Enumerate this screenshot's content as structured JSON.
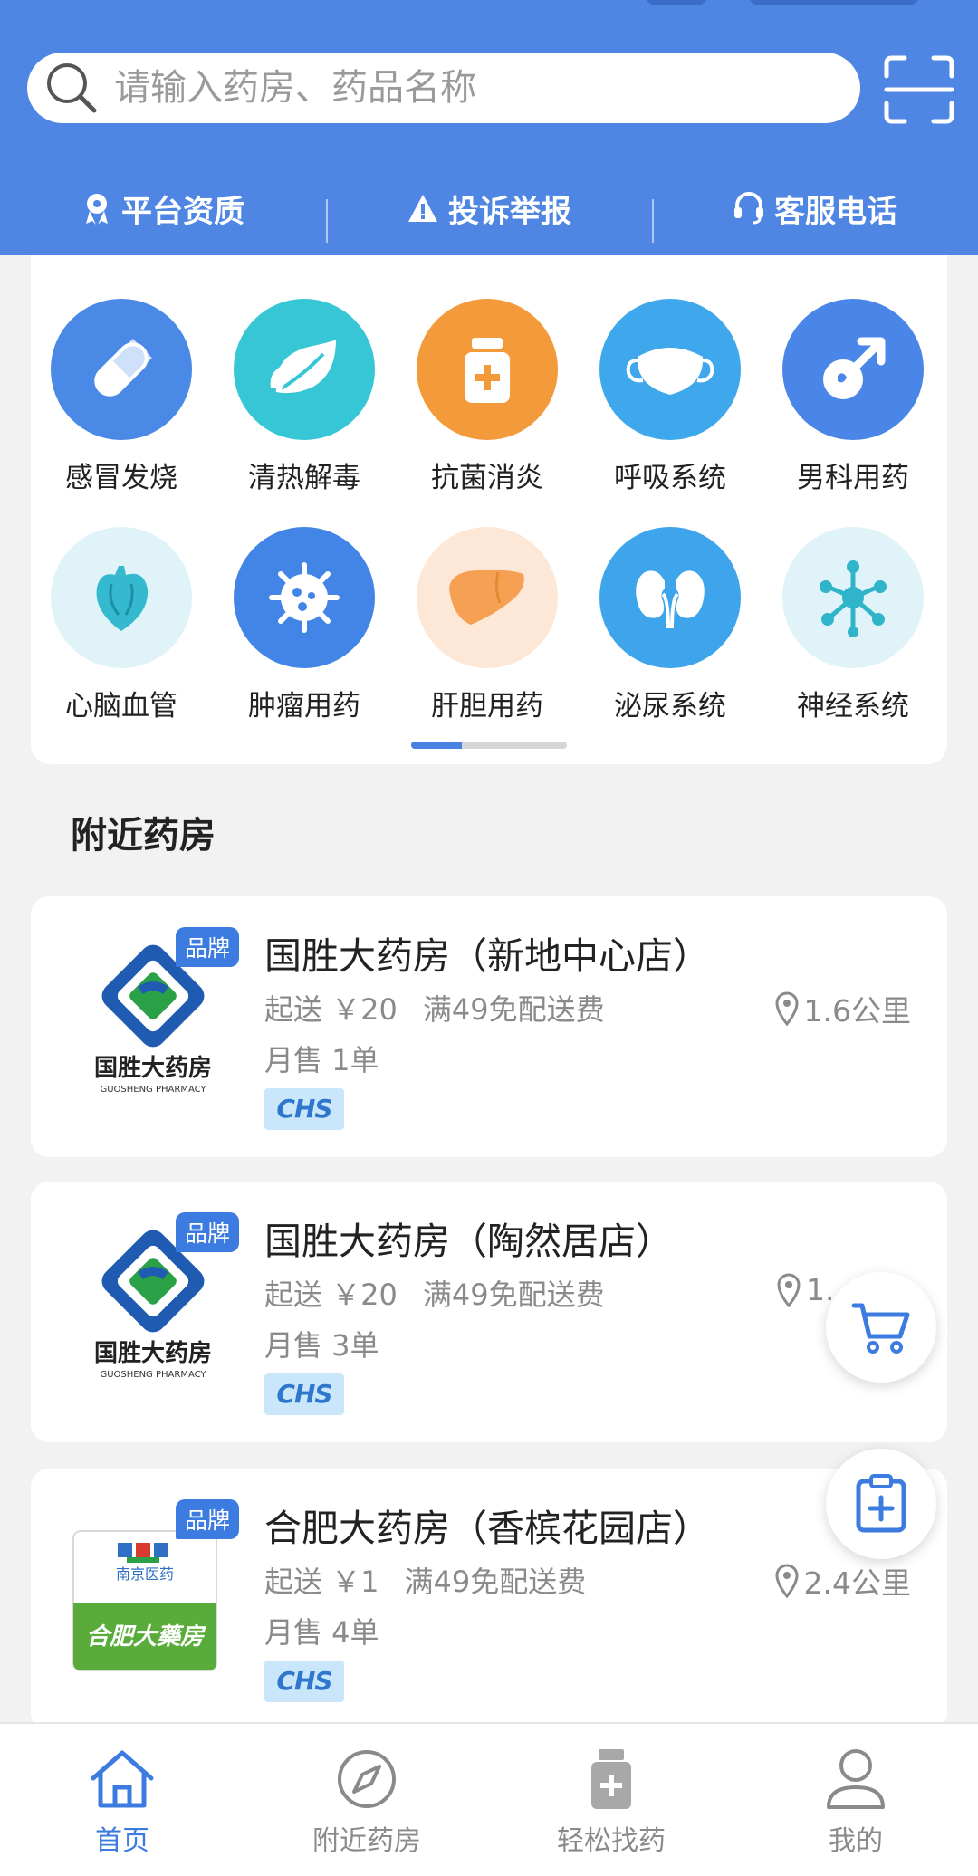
{
  "header": {
    "search_placeholder": "请输入药房、药品名称",
    "links": [
      {
        "label": "平台资质",
        "icon": "qualification-icon"
      },
      {
        "label": "投诉举报",
        "icon": "warning-icon"
      },
      {
        "label": "客服电话",
        "icon": "headset-icon"
      }
    ]
  },
  "categories": [
    {
      "label": "感冒发烧",
      "icon": "pill-icon",
      "color": "#4a8ae6"
    },
    {
      "label": "清热解毒",
      "icon": "leaf-icon",
      "color": "#36c6d6"
    },
    {
      "label": "抗菌消炎",
      "icon": "medicine-bottle-icon",
      "color": "#f39a3b"
    },
    {
      "label": "呼吸系统",
      "icon": "mask-icon",
      "color": "#3fa8ec"
    },
    {
      "label": "男科用药",
      "icon": "male-symbol-icon",
      "color": "#4a85e8"
    },
    {
      "label": "心脑血管",
      "icon": "heart-icon",
      "color": "#dff3f8"
    },
    {
      "label": "肿瘤用药",
      "icon": "virus-icon",
      "color": "#4385e6"
    },
    {
      "label": "肝胆用药",
      "icon": "liver-icon",
      "color": "#fde7d6"
    },
    {
      "label": "泌尿系统",
      "icon": "kidney-icon",
      "color": "#3ea5ec"
    },
    {
      "label": "神经系统",
      "icon": "neuron-icon",
      "color": "#dff3f8"
    }
  ],
  "section": {
    "title": "附近药房"
  },
  "pharmacies": [
    {
      "badge": "品牌",
      "name": "国胜大药房（新地中心店）",
      "delivery": "起送 ￥20",
      "free": "满49免配送费",
      "monthly": "月售 1单",
      "distance": "1.6公里",
      "tag": "CHS",
      "logo_text": "国胜大药房",
      "logo_sub": "GUOSHENG PHARMACY"
    },
    {
      "badge": "品牌",
      "name": "国胜大药房（陶然居店）",
      "delivery": "起送 ￥20",
      "free": "满49免配送费",
      "monthly": "月售 3单",
      "distance": "1.",
      "tag": "CHS",
      "logo_text": "国胜大药房",
      "logo_sub": "GUOSHENG PHARMACY"
    },
    {
      "badge": "品牌",
      "name": "合肥大药房（香槟花园店）",
      "delivery": "起送 ￥1",
      "free": "满49免配送费",
      "monthly": "月售 4单",
      "distance": "2.4公里",
      "tag": "CHS",
      "logo_text": "合肥大藥房",
      "logo_sub": "南京医药"
    }
  ],
  "bottom_nav": [
    {
      "label": "首页",
      "icon": "home-icon",
      "active": true
    },
    {
      "label": "附近药房",
      "icon": "compass-icon",
      "active": false
    },
    {
      "label": "轻松找药",
      "icon": "medicine-bottle-icon",
      "active": false
    },
    {
      "label": "我的",
      "icon": "user-icon",
      "active": false
    }
  ],
  "colors": {
    "primary": "#4f86e3",
    "accent": "#3c7be0",
    "page_bg": "#f2f2f2"
  }
}
